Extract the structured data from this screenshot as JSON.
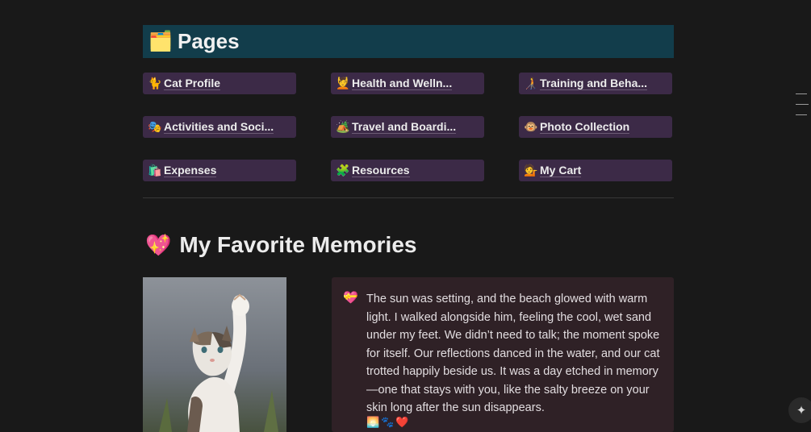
{
  "pages_section": {
    "icon": "🗂️",
    "icon_name": "card-index-dividers-icon",
    "title": "Pages",
    "header_color": "#123d4b",
    "button_color": "#3c2a47",
    "items": [
      {
        "icon": "🐈",
        "label": "Cat Profile"
      },
      {
        "icon": "💆",
        "label": "Health and Welln..."
      },
      {
        "icon": "🧑‍🦯",
        "label": "Training and Beha..."
      },
      {
        "icon": "🎭",
        "label": "Activities and Soci..."
      },
      {
        "icon": "🏕️",
        "label": "Travel and Boardi..."
      },
      {
        "icon": "🐵",
        "label": "Photo Collection"
      },
      {
        "icon": "🛍️",
        "label": "Expenses"
      },
      {
        "icon": "🧩",
        "label": "Resources"
      },
      {
        "icon": "💁",
        "label": "My Cart"
      }
    ]
  },
  "memories_section": {
    "icon": "💖",
    "icon_name": "sparkling-heart-icon",
    "title": "My Favorite Memories",
    "card": {
      "icon": "💝",
      "text": "The sun was setting, and the beach glowed with warm light. I walked alongside him, feeling the cool, wet sand under my feet. We didn’t need to talk; the moment spoke for itself. Our reflections danced in the water, and our cat trotted happily beside us. It was a day etched in memory—one that stays with you, like the salty breeze on your skin long after the sun disappears.",
      "emoji_trail": "🌅🐾❤️",
      "background": "#2f2126"
    }
  },
  "ai_button": {
    "icon": "✦"
  }
}
